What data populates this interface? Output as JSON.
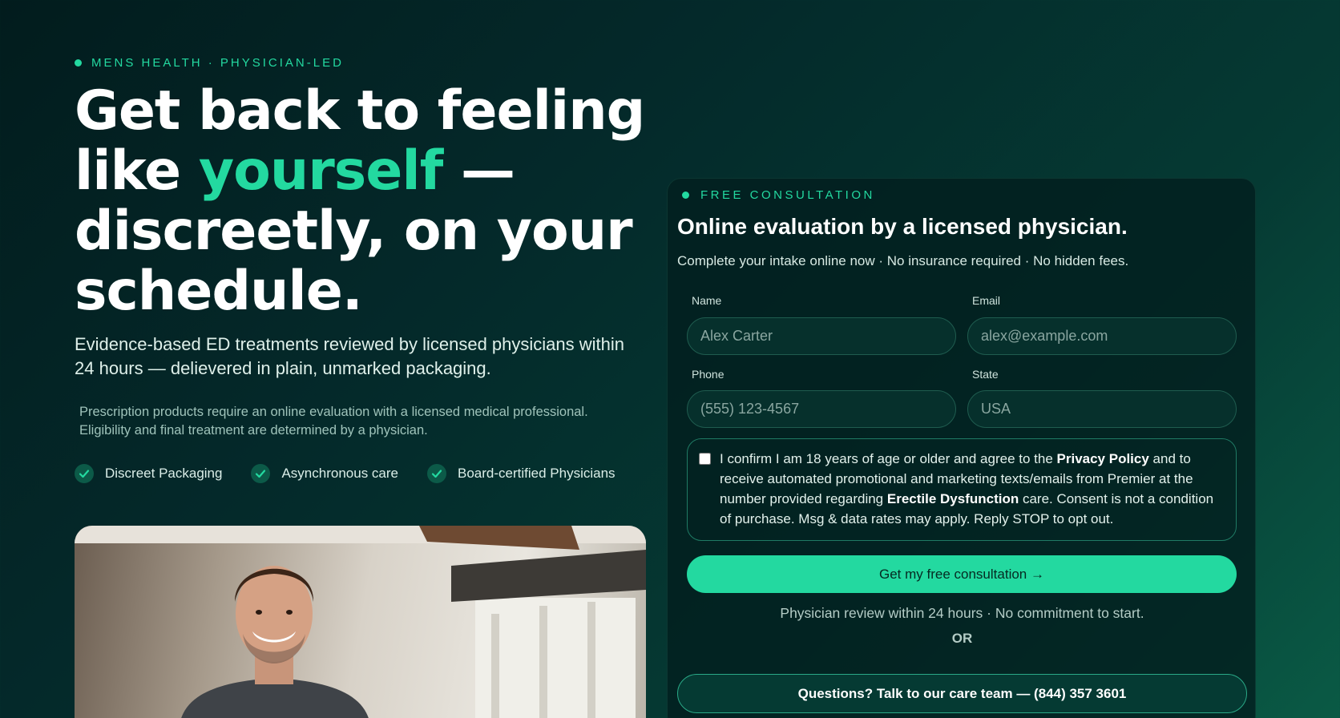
{
  "hero": {
    "eyebrow": "MENS HEALTH · PHYSICIAN-LED",
    "headline_part1": "Get back to feeling like ",
    "headline_accent": "yourself",
    "headline_part2": " — discreetly, on your schedule.",
    "subheadline": "Evidence-based ED treatments reviewed by licensed physicians within 24 hours — delievered in plain, unmarked packaging.",
    "disclaimer": "Prescription products require an online evaluation with a licensed medical professional. Eligibility and final treatment are determined by a physician.",
    "features": [
      "Discreet Packaging",
      "Asynchronous care",
      "Board-certified Physicians"
    ]
  },
  "form": {
    "eyebrow": "FREE CONSULTATION",
    "title": "Online evaluation by a licensed physician.",
    "subtitle": "Complete your intake online now · No insurance required · No hidden fees.",
    "name_label": "Name",
    "name_placeholder": "Alex Carter",
    "email_label": "Email",
    "email_placeholder": "alex@example.com",
    "phone_label": "Phone",
    "phone_placeholder": "(555) 123-4567",
    "state_label": "State",
    "state_placeholder": "USA",
    "consent_part1": "I confirm I am 18 years of age or older and agree to the ",
    "consent_privacy": "Privacy Policy",
    "consent_part2": " and to receive automated promotional and marketing texts/emails from Premier at the number provided regarding ",
    "consent_condition": "Erectile Dysfunction",
    "consent_part3": " care. Consent is not a condition of purchase. Msg & data rates may apply. Reply STOP to opt out.",
    "consent_checked": false,
    "cta_label": "Get my free consultation →",
    "note": "Physician review within 24 hours · No commitment to start.",
    "or_label": "OR",
    "phone_cta": "Questions? Talk to our care team — (844) 357 3601"
  },
  "colors": {
    "accent": "#23d9a0",
    "background": "#03292a"
  },
  "icons": {
    "feature_icon": "check-icon",
    "eyebrow_icon": "dot-icon"
  }
}
